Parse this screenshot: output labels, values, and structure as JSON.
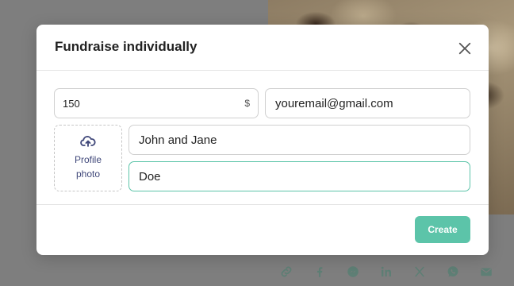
{
  "modal": {
    "title": "Fundraise individually",
    "amount": {
      "value": "150",
      "currency_symbol": "$"
    },
    "email": {
      "value": "youremail@gmail.com"
    },
    "profile_photo": {
      "label": "Profile photo",
      "icon": "cloud-upload-icon"
    },
    "first_name": {
      "value": "John and Jane"
    },
    "last_name": {
      "value": "Doe"
    },
    "create_label": "Create",
    "close_icon": "close-icon"
  },
  "share_bar": {
    "icons": [
      "link-icon",
      "facebook-icon",
      "messenger-icon",
      "linkedin-icon",
      "x-icon",
      "whatsapp-icon",
      "email-icon"
    ]
  },
  "colors": {
    "accent": "#5cc4a9",
    "backdrop": "#7e7e7e",
    "focus_border": "#5cc4a9",
    "photo_text": "#40487a"
  }
}
